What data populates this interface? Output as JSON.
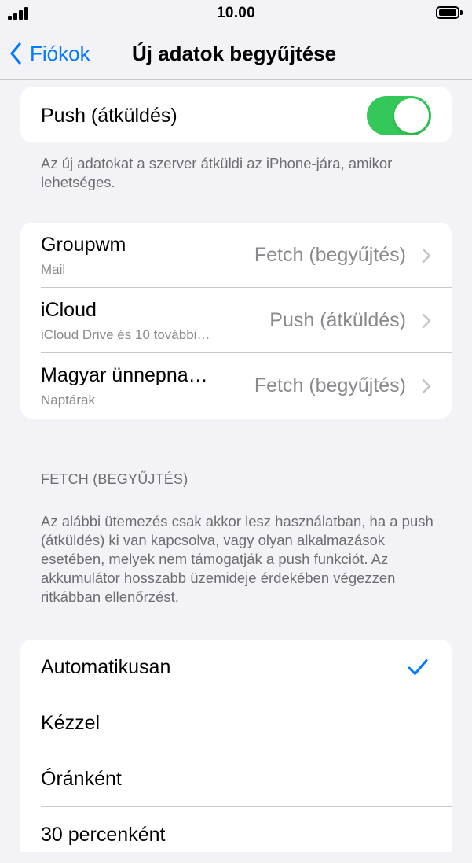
{
  "status_bar": {
    "time": "10.00"
  },
  "nav": {
    "back_label": "Fiókok",
    "title": "Új adatok begyűjtése"
  },
  "push": {
    "label": "Push (átküldés)",
    "enabled": true,
    "footer": "Az új adatokat a szerver átküldi az iPhone-jára, amikor lehetséges."
  },
  "accounts": [
    {
      "name": "Groupwm",
      "subtitle": "Mail",
      "value": "Fetch (begyűjtés)"
    },
    {
      "name": "iCloud",
      "subtitle": "iCloud Drive és 10 további…",
      "value": "Push (átküldés)"
    },
    {
      "name": "Magyar ünnepna…",
      "subtitle": "Naptárak",
      "value": "Fetch (begyűjtés)"
    }
  ],
  "fetch": {
    "header": "FETCH (BEGYŰJTÉS)",
    "description": "Az alábbi ütemezés csak akkor lesz használatban, ha a push (átküldés) ki van kapcsolva, vagy olyan alkalmazások esetében, melyek nem támogatják a push funkciót. Az akkumulátor hosszabb üzemideje érdekében végezzen ritkábban ellenőrzést.",
    "options": [
      {
        "label": "Automatikusan",
        "selected": true
      },
      {
        "label": "Kézzel",
        "selected": false
      },
      {
        "label": "Óránként",
        "selected": false
      },
      {
        "label": "30 percenként",
        "selected": false
      }
    ]
  },
  "colors": {
    "accent": "#007aff",
    "toggle_on": "#34c759",
    "background": "#f2f2f7",
    "secondary_text": "#8a8a8e"
  }
}
